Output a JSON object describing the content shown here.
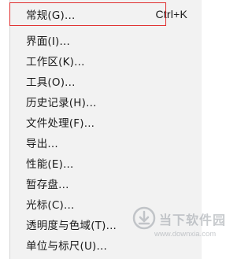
{
  "menu": {
    "items": [
      {
        "label": "常规(G)...",
        "shortcut": "Ctrl+K"
      },
      {
        "label": "界面(I)..."
      },
      {
        "label": "工作区(K)..."
      },
      {
        "label": "工具(O)..."
      },
      {
        "label": "历史记录(H)..."
      },
      {
        "label": "文件处理(F)..."
      },
      {
        "label": "导出..."
      },
      {
        "label": "性能(E)..."
      },
      {
        "label": "暂存盘..."
      },
      {
        "label": "光标(C)..."
      },
      {
        "label": "透明度与色域(T)..."
      },
      {
        "label": "单位与标尺(U)..."
      }
    ]
  },
  "highlight": {
    "color": "#e03030"
  },
  "watermark": {
    "logo_icon": "downxia-logo-icon",
    "text": "当下软件园",
    "url": "www.downxia.com"
  }
}
